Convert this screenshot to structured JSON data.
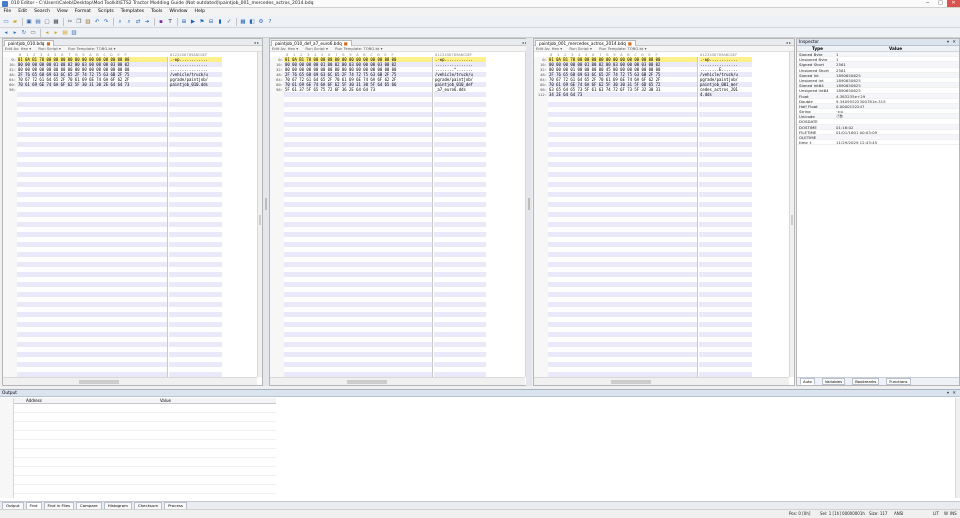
{
  "window": {
    "title": "010 Editor - C:\\Users\\Caleb\\Desktop\\Mod Toolkit\\ETS2 Tractor Modding Guide (Not outdated)\\paintjob_001_mercedes_actros_2014.bdq",
    "buttons": {
      "minimize": "─",
      "maximize": "□",
      "close": "✕"
    }
  },
  "menu": [
    "File",
    "Edit",
    "Search",
    "View",
    "Format",
    "Scripts",
    "Templates",
    "Tools",
    "Window",
    "Help"
  ],
  "toolbar": {
    "icons": [
      "new-file",
      "open-folder",
      "save",
      "save-all",
      "close-file",
      "print",
      "cut",
      "copy",
      "paste",
      "undo",
      "redo",
      "find",
      "find-in-files",
      "replace",
      "goto",
      "hex-mode",
      "text-mode",
      "run-template",
      "run-script",
      "bookmark",
      "compare",
      "histogram",
      "checksum",
      "calculator",
      "inspector",
      "options",
      "help"
    ],
    "icons2": [
      "back",
      "forward",
      "refresh",
      "select-all",
      "bookmark-prev",
      "bookmark-next",
      "template-toggle",
      "script-toggle"
    ]
  },
  "editors": [
    {
      "tab": "paintjob_010.bdq",
      "run_script": "Edit As: Hex ▾",
      "script": "Run Script ▾",
      "template": "Run Template: TOBG.bt ▾",
      "col_header": "0  1  2  3  4  5  6  7  8  9  A  B  C  D  E  F",
      "char_header": "0123456789ABCDEF",
      "offsets": [
        "0:",
        "16:",
        "32:",
        "48:",
        "64:",
        "80:",
        "96:"
      ],
      "hex": [
        "01 0A B1 70 00 00 00 00 00 00 00 00 00 00 00 00",
        "00 00 00 00 00 01 00 02 00 03 00 00 00 03 00 02",
        "00 00 00 00 00 00 00 00 00 00 00 00 00 00 00 00",
        "2F 76 65 68 69 63 6C 65 2F 74 72 75 63 6B 2F 75",
        "70 67 72 61 64 65 2F 70 61 69 6E 74 6A 6F 62 2F",
        "70 61 69 6E 74 6A 6F 62 5F 30 31 30 2E 64 64 73",
        ""
      ],
      "chars": [
        ".·±p............",
        "................",
        "................",
        "/vehicle/truck/u",
        "pgrade/paintjob/",
        "paintjob_010.dds",
        ""
      ]
    },
    {
      "tab": "paintjob_010_def_a7_euro6.bdq",
      "run_script": "Edit As: Hex ▾",
      "script": "Run Script ▾",
      "template": "Run Template: TOBG.bt ▾",
      "col_header": "0  1  2  3  4  5  6  7  8  9  A  B  C  D  E  F",
      "char_header": "0123456789ABCDEF",
      "offsets": [
        "0:",
        "16:",
        "32:",
        "48:",
        "64:",
        "80:",
        "96:"
      ],
      "hex": [
        "01 0A B1 70 00 00 00 00 00 00 00 00 00 00 00 00",
        "00 00 00 00 00 01 00 02 00 03 00 00 00 03 00 02",
        "00 00 00 00 00 00 00 00 00 00 00 00 00 00 00 00",
        "2F 76 65 68 69 63 6C 65 2F 74 72 75 63 6B 2F 75",
        "70 67 72 61 64 65 2F 70 61 69 6E 74 6A 6F 62 2F",
        "70 61 69 6E 74 6A 6F 62 5F 30 31 30 5F 64 65 66",
        "5F 61 37 5F 65 75 72 6F 36 2E 64 64 73"
      ],
      "chars": [
        ".·±p............",
        "................",
        "........^.......",
        "/vehicle/truck/u",
        "pgrade/paintjob/",
        "paintjob_010_def",
        "_a7_euro6.dds"
      ]
    },
    {
      "tab": "paintjob_001_mercedes_actros_2014.bdq",
      "run_script": "Edit As: Hex ▾",
      "script": "Run Script ▾",
      "template": "Run Template: TOBG.bt ▾",
      "col_header": "0  1  2  3  4  5  6  7  8  9  A  B  C  D  E  F",
      "char_header": "0123456789ABCDEF",
      "offsets": [
        "0:",
        "16:",
        "32:",
        "48:",
        "64:",
        "80:",
        "96:",
        "112:"
      ],
      "hex": [
        "01 0A B1 70 00 00 00 00 00 00 00 00 00 00 00 00",
        "00 00 00 00 00 01 00 02 00 03 00 00 00 03 00 02",
        "00 00 00 01 00 00 00 00 45 00 00 00 00 00 00 00",
        "2F 76 65 68 69 63 6C 65 2F 74 72 75 63 6B 2F 75",
        "70 67 72 61 64 65 2F 70 61 69 6E 74 6A 6F 62 2F",
        "70 61 69 6E 74 6A 6F 62 5F 30 30 31 5F 6D 65 72",
        "63 65 64 65 73 5F 61 63 74 72 6F 73 5F 32 30 31",
        "34 2E 64 64 73"
      ],
      "chars": [
        ".·±p............",
        "................",
        "........E.......",
        "/vehicle/truck/u",
        "pgrade/paintjob/",
        "paintjob_001_mer",
        "cedes_actros_201",
        "4.dds"
      ]
    }
  ],
  "inspector": {
    "title": "Inspector",
    "col_type": "Type",
    "col_value": "Value",
    "rows": [
      [
        "Signed Byte",
        "1"
      ],
      [
        "Unsigned Byte",
        "1"
      ],
      [
        "Signed Short",
        "2561"
      ],
      [
        "Unsigned Short",
        "2561"
      ],
      [
        "Signed Int",
        "1890650625"
      ],
      [
        "Unsigned Int",
        "1890650625"
      ],
      [
        "Signed Int64",
        "1890650625"
      ],
      [
        "Unsigned Int64",
        "1890650625"
      ],
      [
        "Float",
        "4.383235e+29"
      ],
      [
        "Double",
        "9.34095522300781e-315"
      ],
      [
        "Half Float",
        "0.0000152247"
      ],
      [
        "String",
        "·±p"
      ],
      [
        "Unicode",
        "ਁ炱"
      ],
      [
        "DOSDATE",
        ""
      ],
      [
        "DOSTIME",
        "01:16:02"
      ],
      [
        "FILETIME",
        "01/01/1601 00:03:09"
      ],
      [
        "OLETIME",
        ""
      ],
      [
        "time_t",
        "11/29/2029 12:43:45"
      ]
    ],
    "tabs": [
      "Auto",
      "Variables",
      "Bookmarks",
      "Functions"
    ]
  },
  "output": {
    "title": "Output",
    "col_address": "Address",
    "col_value": "Value"
  },
  "bottom_tabs": [
    "Output",
    "Find",
    "Find in Files",
    "Compare",
    "Histogram",
    "Checksum",
    "Process"
  ],
  "status": {
    "pos": "Pos: 0 [0h]",
    "sel": "Sel: 1 [1h] 00000001h",
    "size": "Size: 117",
    "encoding": "ANSI",
    "mode1": "LIT",
    "mode2": "W",
    "mode3": "INS"
  }
}
